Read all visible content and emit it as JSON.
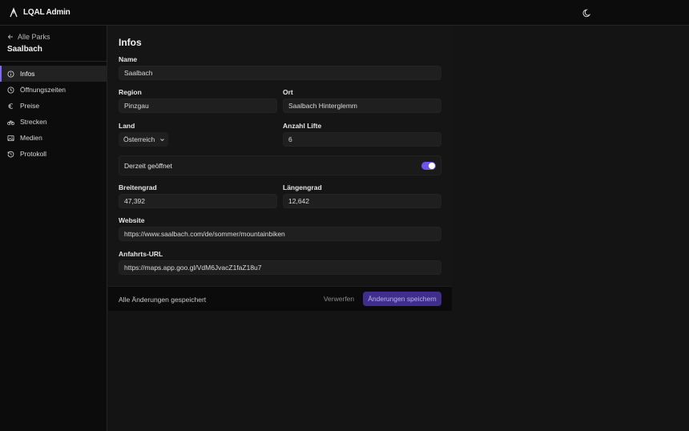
{
  "app": {
    "title": "LQAL Admin"
  },
  "sidebar": {
    "back_label": "Alle Parks",
    "park_name": "Saalbach",
    "items": [
      {
        "label": "Infos",
        "icon": "info-icon"
      },
      {
        "label": "Öffnungszeiten",
        "icon": "clock-icon"
      },
      {
        "label": "Preise",
        "icon": "euro-icon"
      },
      {
        "label": "Strecken",
        "icon": "bike-icon"
      },
      {
        "label": "Medien",
        "icon": "image-icon"
      },
      {
        "label": "Protokoll",
        "icon": "history-icon"
      }
    ],
    "active_index": 0
  },
  "form": {
    "heading": "Infos",
    "name": {
      "label": "Name",
      "value": "Saalbach"
    },
    "region": {
      "label": "Region",
      "value": "Pinzgau"
    },
    "ort": {
      "label": "Ort",
      "value": "Saalbach Hinterglemm"
    },
    "land": {
      "label": "Land",
      "value": "Österreich"
    },
    "lifte": {
      "label": "Anzahl Lifte",
      "value": "6"
    },
    "open_toggle": {
      "label": "Derzeit geöffnet",
      "on": true
    },
    "breitengrad": {
      "label": "Breitengrad",
      "value": "47,392"
    },
    "laengengrad": {
      "label": "Längengrad",
      "value": "12,642"
    },
    "website": {
      "label": "Website",
      "value": "https://www.saalbach.com/de/sommer/mountainbiken"
    },
    "anfahrt": {
      "label": "Anfahrts-URL",
      "value": "https://maps.app.goo.gl/VdM6JvacZ1faZ18u7"
    }
  },
  "footer": {
    "status": "Alle Änderungen gespeichert",
    "discard_label": "Verwerfen",
    "save_label": "Änderungen speichern"
  },
  "colors": {
    "accent": "#6b57e6",
    "save_button_bg": "#3f2f8a",
    "background": "#141414"
  }
}
